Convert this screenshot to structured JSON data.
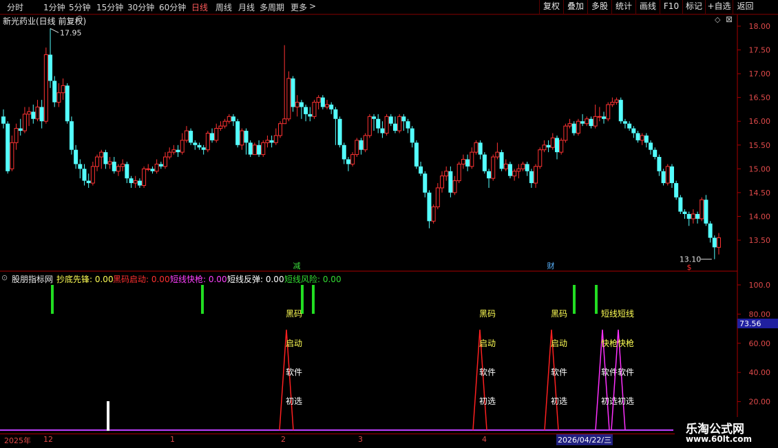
{
  "toolbar": {
    "periods": [
      {
        "label": "分时",
        "active": false
      },
      {
        "label": "1分钟",
        "active": false
      },
      {
        "label": "5分钟",
        "active": false
      },
      {
        "label": "15分钟",
        "active": false
      },
      {
        "label": "30分钟",
        "active": false
      },
      {
        "label": "60分钟",
        "active": false
      },
      {
        "label": "日线",
        "active": true
      },
      {
        "label": "周线",
        "active": false
      },
      {
        "label": "月线",
        "active": false
      },
      {
        "label": "多周期",
        "active": false
      },
      {
        "label": "更多",
        "active": false
      }
    ],
    "more_arrow": ">",
    "tools": [
      "复权",
      "叠加",
      "多股",
      "统计",
      "画线",
      "F10",
      "标记",
      "+自选",
      "返回"
    ]
  },
  "main_chart": {
    "title": "新光药业(日线 前复权)",
    "high_label": "17.95",
    "low_label": "13.10",
    "markers": [
      {
        "text": "减",
        "color": "#3cdc3c"
      },
      {
        "text": "财",
        "color": "#5ab4ff"
      },
      {
        "text": "$",
        "color": "#ff3030"
      }
    ],
    "y_ticks": [
      "18.00",
      "17.50",
      "17.00",
      "16.50",
      "16.00",
      "15.50",
      "15.00",
      "14.50",
      "14.00",
      "13.50"
    ],
    "colors": {
      "up": "#ff3333",
      "down": "#54ffff"
    }
  },
  "indicator": {
    "name": "股朋指标网",
    "fields": [
      {
        "label": "抄底先锋: 0.00",
        "color": "#ffff55"
      },
      {
        "label": "黑码启动: 0.00",
        "color": "#ff3030"
      },
      {
        "label": "短线快枪: 0.00",
        "color": "#ff40ff"
      },
      {
        "label": "短线反弹: 0.00",
        "color": "#ffffff"
      },
      {
        "label": "短线风险: 0.00",
        "color": "#33dd33"
      }
    ],
    "y_ticks": [
      "100.0",
      "80.00",
      "60.00",
      "40.00",
      "20.00"
    ],
    "current_value": "73.56",
    "signals": [
      {
        "labels": [
          "黑码",
          "启动",
          "软件",
          "初选"
        ]
      },
      {
        "labels": [
          "黑码",
          "启动",
          "软件",
          "初选"
        ]
      },
      {
        "labels": [
          "黑码",
          "启动",
          "软件",
          "初选"
        ]
      },
      {
        "labels": [
          "短线",
          "快枪",
          "软件",
          "初选"
        ]
      },
      {
        "labels": [
          "短线",
          "快枪",
          "软件",
          "初选"
        ]
      }
    ]
  },
  "time_axis": {
    "labels": [
      "2025年",
      "12",
      "1",
      "2",
      "3",
      "4"
    ],
    "cursor_date": "2026/04/22/三"
  },
  "watermark": {
    "line1": "乐淘公式网",
    "line2": "www.60lt.com"
  },
  "chart_data": {
    "type": "candlestick",
    "title": "新光药业(日线 前复权)",
    "ylim": [
      13.1,
      18.1
    ],
    "candles": [
      {
        "o": 16.1,
        "c": 15.95,
        "h": 16.25,
        "l": 15.85
      },
      {
        "o": 15.95,
        "c": 14.95,
        "h": 16.0,
        "l": 14.9
      },
      {
        "o": 15.0,
        "c": 15.55,
        "h": 15.7,
        "l": 14.95
      },
      {
        "o": 15.55,
        "c": 15.85,
        "h": 15.95,
        "l": 15.4
      },
      {
        "o": 15.85,
        "c": 15.8,
        "h": 16.05,
        "l": 15.7
      },
      {
        "o": 15.8,
        "c": 16.15,
        "h": 16.3,
        "l": 15.75
      },
      {
        "o": 16.15,
        "c": 16.2,
        "h": 16.3,
        "l": 15.9
      },
      {
        "o": 16.2,
        "c": 16.05,
        "h": 16.35,
        "l": 15.95
      },
      {
        "o": 16.05,
        "c": 16.3,
        "h": 16.45,
        "l": 16.0
      },
      {
        "o": 16.3,
        "c": 16.0,
        "h": 16.45,
        "l": 15.85
      },
      {
        "o": 16.0,
        "c": 17.4,
        "h": 17.55,
        "l": 15.95
      },
      {
        "o": 17.4,
        "c": 16.85,
        "h": 17.95,
        "l": 16.7
      },
      {
        "o": 16.85,
        "c": 16.4,
        "h": 16.95,
        "l": 16.3
      },
      {
        "o": 16.4,
        "c": 16.6,
        "h": 16.8,
        "l": 16.3
      },
      {
        "o": 16.6,
        "c": 16.75,
        "h": 16.9,
        "l": 16.45
      },
      {
        "o": 16.75,
        "c": 16.0,
        "h": 16.8,
        "l": 15.95
      },
      {
        "o": 16.0,
        "c": 15.4,
        "h": 16.1,
        "l": 15.3
      },
      {
        "o": 15.4,
        "c": 15.1,
        "h": 15.5,
        "l": 15.0
      },
      {
        "o": 15.1,
        "c": 15.0,
        "h": 15.2,
        "l": 14.8
      },
      {
        "o": 15.0,
        "c": 14.75,
        "h": 15.1,
        "l": 14.65
      },
      {
        "o": 14.75,
        "c": 14.7,
        "h": 14.9,
        "l": 14.6
      },
      {
        "o": 14.7,
        "c": 15.05,
        "h": 15.15,
        "l": 14.65
      },
      {
        "o": 15.05,
        "c": 15.25,
        "h": 15.3,
        "l": 14.95
      },
      {
        "o": 15.25,
        "c": 15.35,
        "h": 15.4,
        "l": 15.0
      },
      {
        "o": 15.35,
        "c": 15.1,
        "h": 15.4,
        "l": 15.0
      },
      {
        "o": 15.1,
        "c": 15.15,
        "h": 15.25,
        "l": 15.0
      },
      {
        "o": 15.15,
        "c": 14.95,
        "h": 15.25,
        "l": 14.9
      },
      {
        "o": 14.95,
        "c": 15.05,
        "h": 15.1,
        "l": 14.85
      },
      {
        "o": 15.05,
        "c": 15.1,
        "h": 15.2,
        "l": 14.95
      },
      {
        "o": 15.1,
        "c": 14.8,
        "h": 15.15,
        "l": 14.7
      },
      {
        "o": 14.8,
        "c": 14.7,
        "h": 14.85,
        "l": 14.6
      },
      {
        "o": 14.7,
        "c": 14.75,
        "h": 14.85,
        "l": 14.6
      },
      {
        "o": 14.75,
        "c": 14.65,
        "h": 14.8,
        "l": 14.6
      },
      {
        "o": 14.65,
        "c": 15.0,
        "h": 15.05,
        "l": 14.6
      },
      {
        "o": 15.0,
        "c": 15.0,
        "h": 15.1,
        "l": 14.95
      },
      {
        "o": 15.0,
        "c": 14.95,
        "h": 15.05,
        "l": 14.9
      },
      {
        "o": 14.95,
        "c": 15.1,
        "h": 15.2,
        "l": 14.9
      },
      {
        "o": 15.1,
        "c": 15.05,
        "h": 15.15,
        "l": 15.0
      },
      {
        "o": 15.05,
        "c": 15.25,
        "h": 15.35,
        "l": 15.0
      },
      {
        "o": 15.25,
        "c": 15.35,
        "h": 15.45,
        "l": 15.2
      },
      {
        "o": 15.35,
        "c": 15.4,
        "h": 15.5,
        "l": 15.3
      },
      {
        "o": 15.4,
        "c": 15.35,
        "h": 15.5,
        "l": 15.25
      },
      {
        "o": 15.35,
        "c": 15.6,
        "h": 15.75,
        "l": 15.3
      },
      {
        "o": 15.6,
        "c": 15.8,
        "h": 15.9,
        "l": 15.55
      },
      {
        "o": 15.8,
        "c": 15.55,
        "h": 15.85,
        "l": 15.5
      },
      {
        "o": 15.55,
        "c": 15.5,
        "h": 15.6,
        "l": 15.4
      },
      {
        "o": 15.5,
        "c": 15.45,
        "h": 15.55,
        "l": 15.4
      },
      {
        "o": 15.45,
        "c": 15.4,
        "h": 15.5,
        "l": 15.3
      },
      {
        "o": 15.4,
        "c": 15.75,
        "h": 15.8,
        "l": 15.35
      },
      {
        "o": 15.75,
        "c": 15.6,
        "h": 15.85,
        "l": 15.55
      },
      {
        "o": 15.6,
        "c": 15.85,
        "h": 15.95,
        "l": 15.55
      },
      {
        "o": 15.85,
        "c": 15.9,
        "h": 16.0,
        "l": 15.8
      },
      {
        "o": 15.9,
        "c": 16.0,
        "h": 16.05,
        "l": 15.85
      },
      {
        "o": 16.0,
        "c": 16.1,
        "h": 16.15,
        "l": 15.95
      },
      {
        "o": 16.1,
        "c": 16.0,
        "h": 16.15,
        "l": 15.9
      },
      {
        "o": 16.0,
        "c": 15.5,
        "h": 16.05,
        "l": 15.45
      },
      {
        "o": 15.5,
        "c": 15.8,
        "h": 15.85,
        "l": 15.4
      },
      {
        "o": 15.8,
        "c": 15.55,
        "h": 15.85,
        "l": 15.3
      },
      {
        "o": 15.55,
        "c": 15.3,
        "h": 15.6,
        "l": 15.25
      },
      {
        "o": 15.3,
        "c": 15.5,
        "h": 15.55,
        "l": 15.3
      },
      {
        "o": 15.5,
        "c": 15.3,
        "h": 15.6,
        "l": 15.25
      },
      {
        "o": 15.3,
        "c": 15.55,
        "h": 15.6,
        "l": 15.25
      },
      {
        "o": 15.55,
        "c": 15.6,
        "h": 15.7,
        "l": 15.45
      },
      {
        "o": 15.6,
        "c": 15.55,
        "h": 15.7,
        "l": 15.45
      },
      {
        "o": 15.55,
        "c": 15.7,
        "h": 15.85,
        "l": 15.5
      },
      {
        "o": 15.7,
        "c": 15.95,
        "h": 16.0,
        "l": 15.65
      },
      {
        "o": 15.95,
        "c": 16.05,
        "h": 17.6,
        "l": 15.95
      },
      {
        "o": 16.05,
        "c": 16.9,
        "h": 17.05,
        "l": 16.0
      },
      {
        "o": 16.9,
        "c": 16.3,
        "h": 16.95,
        "l": 16.2
      },
      {
        "o": 16.3,
        "c": 16.4,
        "h": 16.55,
        "l": 16.1
      },
      {
        "o": 16.4,
        "c": 16.3,
        "h": 16.45,
        "l": 16.05
      },
      {
        "o": 16.3,
        "c": 16.15,
        "h": 16.35,
        "l": 16.0
      },
      {
        "o": 16.15,
        "c": 16.1,
        "h": 16.3,
        "l": 16.0
      },
      {
        "o": 16.1,
        "c": 16.4,
        "h": 16.45,
        "l": 16.05
      },
      {
        "o": 16.4,
        "c": 16.5,
        "h": 16.55,
        "l": 16.25
      },
      {
        "o": 16.5,
        "c": 16.3,
        "h": 16.55,
        "l": 16.25
      },
      {
        "o": 16.3,
        "c": 16.35,
        "h": 16.45,
        "l": 16.25
      },
      {
        "o": 16.35,
        "c": 16.25,
        "h": 16.4,
        "l": 16.15
      },
      {
        "o": 16.25,
        "c": 16.05,
        "h": 16.3,
        "l": 15.5
      },
      {
        "o": 16.05,
        "c": 15.5,
        "h": 16.1,
        "l": 15.45
      },
      {
        "o": 15.5,
        "c": 15.2,
        "h": 15.55,
        "l": 15.1
      },
      {
        "o": 15.2,
        "c": 15.1,
        "h": 15.25,
        "l": 14.95
      },
      {
        "o": 15.1,
        "c": 15.3,
        "h": 15.35,
        "l": 15.05
      },
      {
        "o": 15.3,
        "c": 15.6,
        "h": 15.65,
        "l": 15.25
      },
      {
        "o": 15.6,
        "c": 15.4,
        "h": 15.65,
        "l": 15.3
      },
      {
        "o": 15.4,
        "c": 15.7,
        "h": 15.75,
        "l": 15.35
      },
      {
        "o": 15.7,
        "c": 16.1,
        "h": 16.15,
        "l": 15.65
      },
      {
        "o": 16.1,
        "c": 16.05,
        "h": 16.15,
        "l": 15.8
      },
      {
        "o": 16.05,
        "c": 15.85,
        "h": 16.15,
        "l": 15.75
      },
      {
        "o": 15.85,
        "c": 15.75,
        "h": 16.0,
        "l": 15.65
      },
      {
        "o": 15.75,
        "c": 16.1,
        "h": 16.15,
        "l": 15.7
      },
      {
        "o": 16.1,
        "c": 15.95,
        "h": 16.15,
        "l": 15.9
      },
      {
        "o": 15.95,
        "c": 15.8,
        "h": 16.1,
        "l": 15.75
      },
      {
        "o": 15.8,
        "c": 16.1,
        "h": 16.15,
        "l": 15.75
      },
      {
        "o": 16.1,
        "c": 16.0,
        "h": 16.15,
        "l": 15.8
      },
      {
        "o": 16.0,
        "c": 15.85,
        "h": 16.05,
        "l": 15.75
      },
      {
        "o": 15.85,
        "c": 15.55,
        "h": 15.9,
        "l": 15.45
      },
      {
        "o": 15.55,
        "c": 15.05,
        "h": 15.6,
        "l": 15.0
      },
      {
        "o": 15.05,
        "c": 14.9,
        "h": 15.15,
        "l": 14.85
      },
      {
        "o": 14.9,
        "c": 14.5,
        "h": 14.95,
        "l": 14.4
      },
      {
        "o": 14.5,
        "c": 13.9,
        "h": 14.55,
        "l": 13.75
      },
      {
        "o": 13.9,
        "c": 14.2,
        "h": 14.25,
        "l": 13.85
      },
      {
        "o": 14.2,
        "c": 14.6,
        "h": 14.7,
        "l": 14.15
      },
      {
        "o": 14.6,
        "c": 14.85,
        "h": 14.95,
        "l": 14.5
      },
      {
        "o": 14.85,
        "c": 14.95,
        "h": 15.05,
        "l": 14.75
      },
      {
        "o": 14.95,
        "c": 14.5,
        "h": 15.05,
        "l": 14.4
      },
      {
        "o": 14.5,
        "c": 14.75,
        "h": 14.85,
        "l": 14.45
      },
      {
        "o": 14.75,
        "c": 15.1,
        "h": 15.15,
        "l": 14.7
      },
      {
        "o": 15.1,
        "c": 15.2,
        "h": 15.3,
        "l": 15.0
      },
      {
        "o": 15.2,
        "c": 15.05,
        "h": 15.3,
        "l": 14.95
      },
      {
        "o": 15.05,
        "c": 15.35,
        "h": 15.45,
        "l": 15.0
      },
      {
        "o": 15.35,
        "c": 15.55,
        "h": 15.6,
        "l": 15.3
      },
      {
        "o": 15.55,
        "c": 15.3,
        "h": 15.6,
        "l": 15.2
      },
      {
        "o": 15.3,
        "c": 14.95,
        "h": 15.35,
        "l": 14.9
      },
      {
        "o": 14.95,
        "c": 14.8,
        "h": 15.0,
        "l": 14.6
      },
      {
        "o": 14.8,
        "c": 15.25,
        "h": 15.3,
        "l": 14.75
      },
      {
        "o": 15.25,
        "c": 15.35,
        "h": 15.55,
        "l": 15.2
      },
      {
        "o": 15.35,
        "c": 15.0,
        "h": 15.4,
        "l": 14.95
      },
      {
        "o": 15.0,
        "c": 15.1,
        "h": 15.2,
        "l": 14.95
      },
      {
        "o": 15.1,
        "c": 14.85,
        "h": 15.15,
        "l": 14.8
      },
      {
        "o": 14.85,
        "c": 14.95,
        "h": 15.0,
        "l": 14.75
      },
      {
        "o": 14.95,
        "c": 15.0,
        "h": 15.1,
        "l": 14.8
      },
      {
        "o": 15.0,
        "c": 15.1,
        "h": 15.15,
        "l": 14.95
      },
      {
        "o": 15.1,
        "c": 14.95,
        "h": 15.15,
        "l": 14.85
      },
      {
        "o": 14.95,
        "c": 14.7,
        "h": 15.0,
        "l": 14.6
      },
      {
        "o": 14.7,
        "c": 15.05,
        "h": 15.1,
        "l": 14.6
      },
      {
        "o": 15.05,
        "c": 15.4,
        "h": 15.45,
        "l": 15.0
      },
      {
        "o": 15.4,
        "c": 15.5,
        "h": 15.6,
        "l": 15.35
      },
      {
        "o": 15.5,
        "c": 15.45,
        "h": 15.6,
        "l": 15.35
      },
      {
        "o": 15.45,
        "c": 15.65,
        "h": 15.75,
        "l": 15.4
      },
      {
        "o": 15.65,
        "c": 15.35,
        "h": 15.7,
        "l": 15.2
      },
      {
        "o": 15.35,
        "c": 15.6,
        "h": 15.65,
        "l": 15.3
      },
      {
        "o": 15.6,
        "c": 15.9,
        "h": 15.95,
        "l": 15.55
      },
      {
        "o": 15.9,
        "c": 15.95,
        "h": 16.05,
        "l": 15.85
      },
      {
        "o": 15.95,
        "c": 15.75,
        "h": 16.0,
        "l": 15.7
      },
      {
        "o": 15.75,
        "c": 16.0,
        "h": 16.05,
        "l": 15.7
      },
      {
        "o": 16.0,
        "c": 15.95,
        "h": 16.15,
        "l": 15.9
      },
      {
        "o": 15.95,
        "c": 16.05,
        "h": 16.1,
        "l": 15.9
      },
      {
        "o": 16.05,
        "c": 15.9,
        "h": 16.1,
        "l": 15.85
      },
      {
        "o": 15.9,
        "c": 16.1,
        "h": 16.35,
        "l": 15.85
      },
      {
        "o": 16.1,
        "c": 16.1,
        "h": 16.3,
        "l": 16.0
      },
      {
        "o": 16.1,
        "c": 16.05,
        "h": 16.2,
        "l": 15.95
      },
      {
        "o": 16.05,
        "c": 16.35,
        "h": 16.4,
        "l": 16.0
      },
      {
        "o": 16.35,
        "c": 16.4,
        "h": 16.5,
        "l": 16.3
      },
      {
        "o": 16.4,
        "c": 16.45,
        "h": 16.5,
        "l": 16.35
      },
      {
        "o": 16.45,
        "c": 16.0,
        "h": 16.5,
        "l": 15.95
      },
      {
        "o": 16.0,
        "c": 15.95,
        "h": 16.05,
        "l": 15.85
      },
      {
        "o": 15.95,
        "c": 15.85,
        "h": 16.0,
        "l": 15.8
      },
      {
        "o": 15.85,
        "c": 15.75,
        "h": 15.9,
        "l": 15.65
      },
      {
        "o": 15.75,
        "c": 15.6,
        "h": 15.8,
        "l": 15.55
      },
      {
        "o": 15.6,
        "c": 15.7,
        "h": 15.75,
        "l": 15.5
      },
      {
        "o": 15.7,
        "c": 15.55,
        "h": 15.75,
        "l": 15.45
      },
      {
        "o": 15.55,
        "c": 15.4,
        "h": 15.6,
        "l": 15.3
      },
      {
        "o": 15.4,
        "c": 15.25,
        "h": 15.45,
        "l": 15.2
      },
      {
        "o": 15.25,
        "c": 14.95,
        "h": 15.3,
        "l": 14.85
      },
      {
        "o": 14.95,
        "c": 14.7,
        "h": 15.0,
        "l": 14.65
      },
      {
        "o": 14.7,
        "c": 15.05,
        "h": 15.1,
        "l": 14.65
      },
      {
        "o": 15.05,
        "c": 14.7,
        "h": 15.1,
        "l": 14.6
      },
      {
        "o": 14.7,
        "c": 14.4,
        "h": 14.75,
        "l": 14.35
      },
      {
        "o": 14.4,
        "c": 14.1,
        "h": 14.45,
        "l": 14.05
      },
      {
        "o": 14.1,
        "c": 14.05,
        "h": 14.15,
        "l": 13.95
      },
      {
        "o": 14.05,
        "c": 13.95,
        "h": 14.1,
        "l": 13.8
      },
      {
        "o": 13.95,
        "c": 14.05,
        "h": 14.15,
        "l": 13.85
      },
      {
        "o": 14.05,
        "c": 13.95,
        "h": 14.1,
        "l": 13.85
      },
      {
        "o": 13.95,
        "c": 14.35,
        "h": 14.4,
        "l": 13.9
      },
      {
        "o": 14.35,
        "c": 13.85,
        "h": 14.45,
        "l": 13.8
      },
      {
        "o": 13.85,
        "c": 13.55,
        "h": 13.9,
        "l": 13.45
      },
      {
        "o": 13.55,
        "c": 13.35,
        "h": 13.6,
        "l": 13.1
      },
      {
        "o": 13.35,
        "c": 13.55,
        "h": 13.65,
        "l": 13.2
      }
    ],
    "indicator_axis": [
      0,
      100
    ],
    "indicator_current": 73.56,
    "green_signal_bars": [
      0.59,
      0.5,
      0.9,
      0.9,
      0.9,
      0.9
    ],
    "white_signal_bar": 0.36
  }
}
